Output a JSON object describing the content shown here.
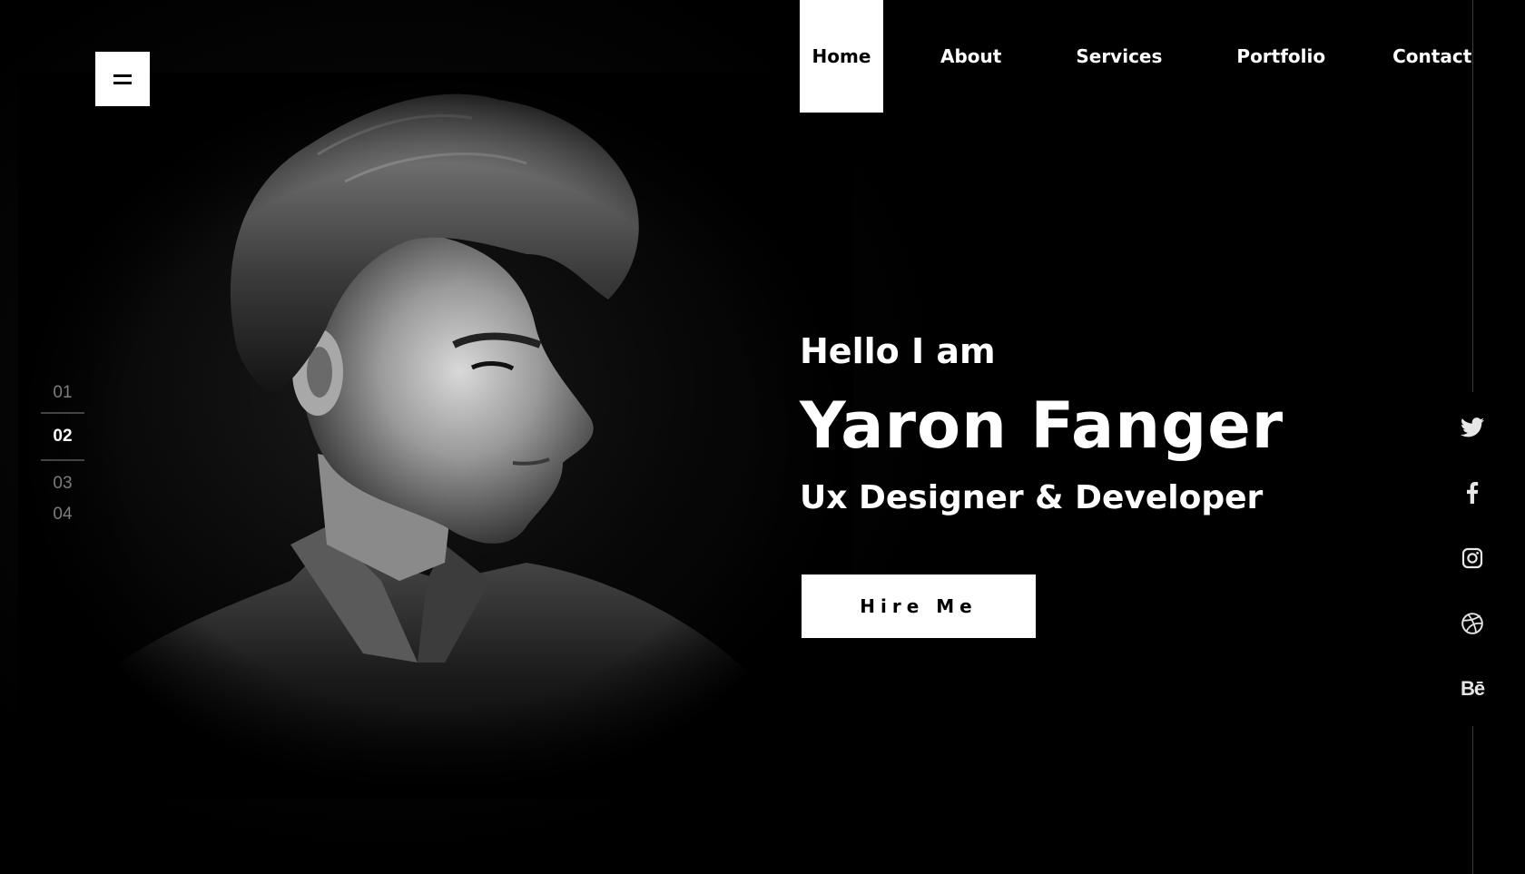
{
  "nav": {
    "items": [
      {
        "label": "Home",
        "active": true
      },
      {
        "label": "About"
      },
      {
        "label": "Services"
      },
      {
        "label": "Portfolio"
      },
      {
        "label": "Contact"
      }
    ]
  },
  "menu_toggle": {
    "icon": "hamburger-icon"
  },
  "pager": [
    "01",
    "02",
    "03",
    "04"
  ],
  "pager_active": "02",
  "hero": {
    "greeting": "Hello I am",
    "name": "Yaron Fanger",
    "role": "Ux Designer & Developer",
    "cta_label": "Hire Me"
  },
  "social": [
    {
      "icon": "twitter-icon"
    },
    {
      "icon": "facebook-icon"
    },
    {
      "icon": "instagram-icon"
    },
    {
      "icon": "dribbble-icon"
    },
    {
      "icon": "behance-icon",
      "text": "Bē"
    }
  ],
  "colors": {
    "background": "#000000",
    "foreground": "#ffffff",
    "muted": "#7d7d7d",
    "rule": "#3a3a3a"
  }
}
